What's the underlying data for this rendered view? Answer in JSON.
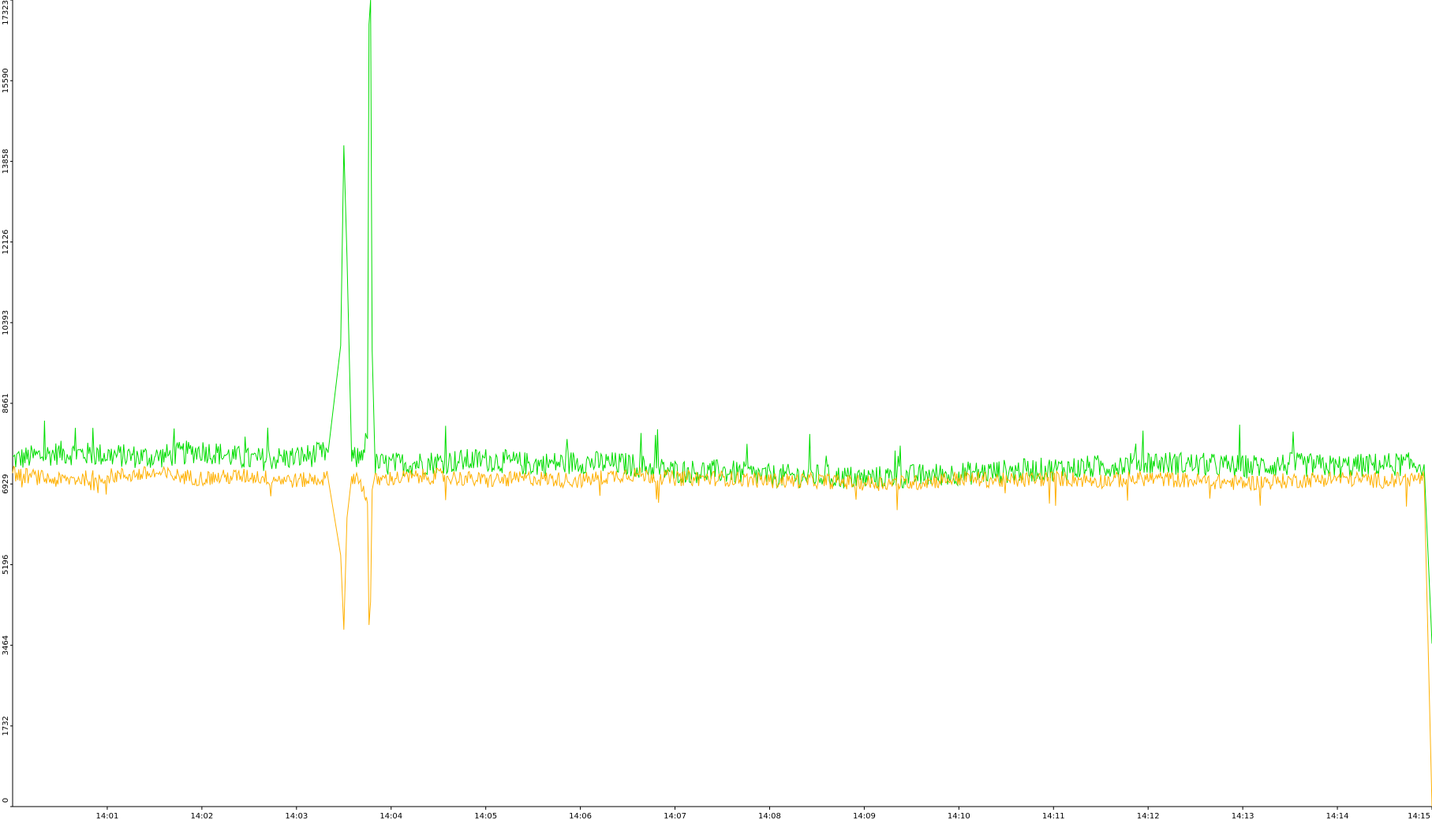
{
  "chart_data": {
    "type": "line",
    "title": "",
    "xlabel": "",
    "ylabel": "",
    "ylim": [
      0,
      17323
    ],
    "yticks": [
      "0",
      "1732",
      "3464",
      "5196",
      "6929",
      "8661",
      "10393",
      "12126",
      "13858",
      "15590",
      "17323"
    ],
    "xlim": [
      "14:00",
      "14:15"
    ],
    "xticks": [
      "14:01",
      "14:02",
      "14:03",
      "14:04",
      "14:05",
      "14:06",
      "14:07",
      "14:08",
      "14:09",
      "14:10",
      "14:11",
      "14:12",
      "14:13",
      "14:14",
      "14:15"
    ],
    "grid": false,
    "legend": "none",
    "series": [
      {
        "color": "#00dd00",
        "x": [
          "14:00:00",
          "14:00:30",
          "14:01:00",
          "14:01:30",
          "14:02:00",
          "14:02:30",
          "14:03:00",
          "14:03:20",
          "14:03:28",
          "14:03:30",
          "14:03:32",
          "14:03:35",
          "14:03:40",
          "14:03:45",
          "14:03:46",
          "14:03:47",
          "14:03:48",
          "14:03:50",
          "14:04:00",
          "14:04:30",
          "14:05:00",
          "14:05:30",
          "14:06:00",
          "14:06:30",
          "14:07:00",
          "14:07:30",
          "14:08:00",
          "14:08:30",
          "14:09:00",
          "14:09:30",
          "14:10:00",
          "14:10:30",
          "14:11:00",
          "14:11:30",
          "14:12:00",
          "14:12:30",
          "14:13:00",
          "14:13:30",
          "14:14:00",
          "14:14:30",
          "14:14:55",
          "14:15:00"
        ],
        "values": [
          7450,
          7600,
          7550,
          7500,
          7650,
          7450,
          7500,
          7600,
          9900,
          14200,
          11800,
          7450,
          7500,
          7900,
          16800,
          17323,
          9800,
          7350,
          7350,
          7400,
          7450,
          7350,
          7400,
          7350,
          7200,
          7200,
          7100,
          7100,
          7050,
          7100,
          7150,
          7200,
          7250,
          7300,
          7400,
          7350,
          7300,
          7350,
          7300,
          7350,
          7350,
          3500
        ]
      },
      {
        "color": "#ffb000",
        "x": [
          "14:00:00",
          "14:00:30",
          "14:01:00",
          "14:01:30",
          "14:02:00",
          "14:02:30",
          "14:03:00",
          "14:03:20",
          "14:03:28",
          "14:03:30",
          "14:03:32",
          "14:03:35",
          "14:03:40",
          "14:03:45",
          "14:03:46",
          "14:03:47",
          "14:03:48",
          "14:03:50",
          "14:04:00",
          "14:04:30",
          "14:05:00",
          "14:05:30",
          "14:06:00",
          "14:06:30",
          "14:07:00",
          "14:07:30",
          "14:08:00",
          "14:08:30",
          "14:09:00",
          "14:09:30",
          "14:10:00",
          "14:10:30",
          "14:11:00",
          "14:11:30",
          "14:12:00",
          "14:12:30",
          "14:13:00",
          "14:13:30",
          "14:14:00",
          "14:14:30",
          "14:14:55",
          "14:15:00"
        ],
        "values": [
          7150,
          7000,
          7100,
          7150,
          7050,
          7100,
          7000,
          7050,
          5400,
          3800,
          6200,
          7100,
          7050,
          6500,
          3900,
          4400,
          6800,
          7000,
          7050,
          7100,
          7000,
          7050,
          7000,
          7150,
          7050,
          7050,
          7000,
          7000,
          6950,
          6950,
          7050,
          7000,
          7050,
          7000,
          7050,
          7000,
          6950,
          7000,
          7050,
          7000,
          7050,
          0
        ]
      }
    ]
  }
}
